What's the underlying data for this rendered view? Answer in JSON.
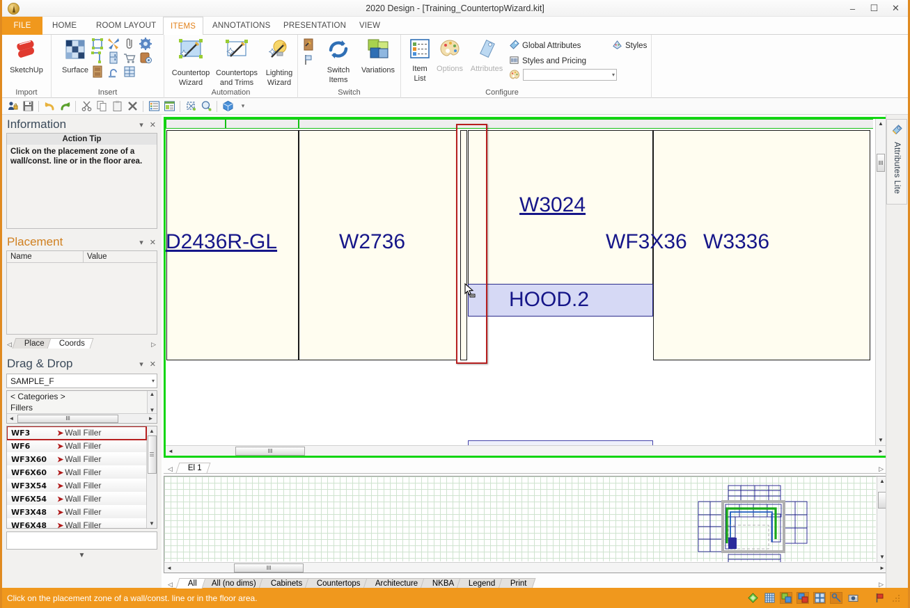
{
  "window": {
    "title": "2020 Design - [Training_CountertopWizard.kit]",
    "app_icon": "app-logo-icon",
    "minimize": "–",
    "maximize": "☐",
    "close": "✕",
    "ribbon_collapse": "˄",
    "doc_minimize": "–",
    "doc_restore": "❐",
    "doc_close": "✕"
  },
  "ribbon": {
    "tabs": [
      {
        "label": "FILE",
        "state": "file"
      },
      {
        "label": "HOME",
        "state": "normal"
      },
      {
        "label": "ROOM LAYOUT",
        "state": "normal"
      },
      {
        "label": "ITEMS",
        "state": "active"
      },
      {
        "label": "ANNOTATIONS",
        "state": "normal"
      },
      {
        "label": "PRESENTATION",
        "state": "normal"
      },
      {
        "label": "VIEW",
        "state": "normal"
      }
    ],
    "groups": [
      {
        "name": "Import",
        "label": "Import"
      },
      {
        "name": "Insert",
        "label": "Insert"
      },
      {
        "name": "Automation",
        "label": "Automation"
      },
      {
        "name": "Switch",
        "label": "Switch"
      },
      {
        "name": "Configure",
        "label": "Configure"
      }
    ],
    "import": {
      "sketchup": "SketchUp"
    },
    "insert": {
      "surface": "Surface",
      "icons": [
        "cabinet-insert-icon",
        "windmill-icon",
        "clip-icon",
        "gear-blue-icon",
        "corner-icon",
        "appliance-icon",
        "cart-icon",
        "barrel-icon",
        "door-icon",
        "faucet-icon",
        "window-grid-icon"
      ]
    },
    "automation": {
      "countertop_wizard": "Countertop\nWizard",
      "countertop_wizard_l1": "Countertop",
      "countertop_wizard_l2": "Wizard",
      "countertops_trims_l1": "Countertops",
      "countertops_trims_l2": "and Trims",
      "lighting_wizard_l1": "Lighting",
      "lighting_wizard_l2": "Wizard"
    },
    "switch": {
      "switch_items_l1": "Switch",
      "switch_items_l2": "Items",
      "variations": "Variations"
    },
    "configure": {
      "item_list_l1": "Item",
      "item_list_l2": "List",
      "options": "Options",
      "attributes": "Attributes",
      "global_attributes": "Global Attributes",
      "styles_and_pricing": "Styles and Pricing",
      "styles": "Styles",
      "style_combo_value": "",
      "style_combo_arrow": "▾"
    }
  },
  "quickbar": {
    "icons": [
      "user-lock-icon",
      "save-icon",
      "undo-icon",
      "redo-icon",
      "cut-icon",
      "copy-icon",
      "paste-icon",
      "delete-icon",
      "list-view-icon",
      "properties-icon",
      "fit-selection-icon",
      "zoom-window-icon",
      "3d-box-icon",
      "overflow-icon"
    ]
  },
  "information_panel": {
    "title": "Information",
    "collapse_icon": "▾",
    "close_icon": "✕",
    "action_tip_header": "Action Tip",
    "action_tip_text": "Click on the placement zone of a wall/const. line or in the floor area."
  },
  "placement_panel": {
    "title": "Placement",
    "collapse_icon": "▾",
    "close_icon": "✕",
    "columns": [
      "Name",
      "Value"
    ],
    "rows": [],
    "tabs": [
      {
        "label": "Place",
        "selected": false
      },
      {
        "label": "Coords",
        "selected": true
      }
    ],
    "prev_arrow": "◁",
    "next_arrow": "▷"
  },
  "dragdrop_panel": {
    "title": "Drag & Drop",
    "collapse_icon": "▾",
    "close_icon": "✕",
    "catalog_value": "SAMPLE_F",
    "catalog_arrow": "▾",
    "category_header": "< Categories >",
    "category_selected": "Fillers",
    "scroll_up": "▲",
    "scroll_down": "▼",
    "hscroll_left": "◄",
    "hscroll_right": "►",
    "hscroll_grip": "‖‖",
    "items": [
      {
        "code": "WF3",
        "desc": "Wall Filler",
        "selected": true
      },
      {
        "code": "WF6",
        "desc": "Wall Filler",
        "selected": false
      },
      {
        "code": "WF3X60",
        "desc": "Wall Filler",
        "selected": false
      },
      {
        "code": "WF6X60",
        "desc": "Wall Filler",
        "selected": false
      },
      {
        "code": "WF3X54",
        "desc": "Wall Filler",
        "selected": false
      },
      {
        "code": "WF6X54",
        "desc": "Wall Filler",
        "selected": false
      },
      {
        "code": "WF3X48",
        "desc": "Wall Filler",
        "selected": false
      },
      {
        "code": "WF6X48",
        "desc": "Wall Filler",
        "selected": false
      }
    ],
    "detail_value": "",
    "footer_arrow": "▼"
  },
  "canvas": {
    "view_label": "El 1",
    "elevation_prev_arrow": "◁",
    "elevation_next_arrow": "▷",
    "cabinets": [
      {
        "label": "D2436R-GL",
        "underline": true
      },
      {
        "label": "W2736",
        "underline": false
      },
      {
        "label": "W3024",
        "underline": true
      },
      {
        "label": "WF3X36",
        "underline": false
      },
      {
        "label": "W3336",
        "underline": false
      },
      {
        "label": "HOOD.2",
        "underline": false
      }
    ],
    "selection_highlight_color": "#b61f1f",
    "viewport_border_color": "#12d612",
    "cabinet_fill_color": "#fffdf0",
    "label_color": "#161689",
    "hood_fill_color": "#d6d9f5",
    "cursor_icon": "drag-drop-cursor-icon",
    "scroll_up": "▲",
    "scroll_down": "▼",
    "scroll_left": "◄",
    "scroll_right": "►",
    "grip": "‖‖"
  },
  "plan_preview": {
    "tabs": [
      {
        "label": "All",
        "selected": true
      },
      {
        "label": "All (no dims)",
        "selected": false
      },
      {
        "label": "Cabinets",
        "selected": false
      },
      {
        "label": "Countertops",
        "selected": false
      },
      {
        "label": "Architecture",
        "selected": false
      },
      {
        "label": "NKBA",
        "selected": false
      },
      {
        "label": "Legend",
        "selected": false
      },
      {
        "label": "Print",
        "selected": false
      }
    ],
    "prev_arrow": "◁",
    "next_arrow": "▷",
    "scroll_left": "◄",
    "scroll_right": "►",
    "scroll_up": "▲",
    "scroll_down": "▼",
    "grip": "‖‖"
  },
  "right_panel": {
    "tab_label": "Attributes Lite",
    "tab_icon": "attributes-tag-icon"
  },
  "statusbar": {
    "message": "Click on the placement zone of a wall/const. line or in the floor area.",
    "background_color": "#f0981d",
    "icons": [
      {
        "name": "snap-diamond-icon",
        "active": false
      },
      {
        "name": "grid-icon",
        "active": false
      },
      {
        "name": "green-shapes-icon",
        "active": true
      },
      {
        "name": "red-shapes-icon",
        "active": true
      },
      {
        "name": "quad-view-icon",
        "active": true
      },
      {
        "name": "link-icon",
        "active": true
      },
      {
        "name": "camera-icon",
        "active": false
      },
      {
        "name": "flag-icon",
        "active": false
      },
      {
        "name": "resize-grip-icon",
        "active": false
      }
    ]
  }
}
